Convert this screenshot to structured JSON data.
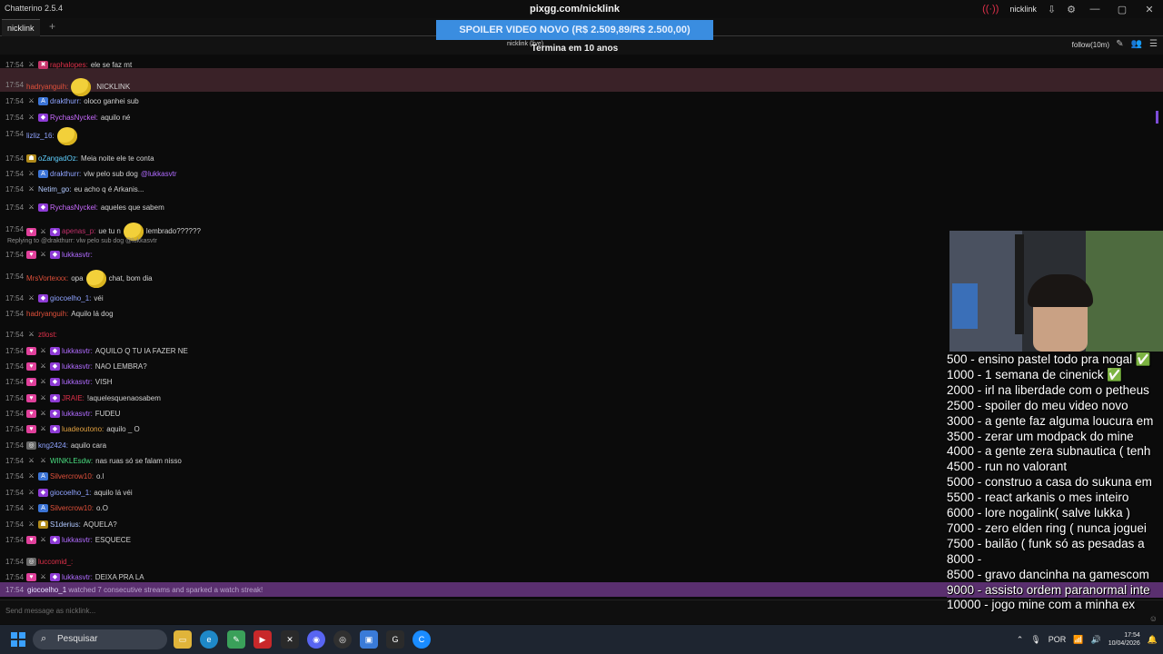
{
  "window": {
    "title": "Chatterino 2.5.4",
    "username": "nicklink"
  },
  "tabs": [
    {
      "label": "nicklink"
    }
  ],
  "banner": {
    "title": "pixgg.com/nicklink",
    "text": "SPOILER VIDEO NOVO (R$ 2.509,89/R$ 2.500,00)",
    "subtitle": "Termina em 10 anos"
  },
  "split_header": {
    "channel": "nicklink (live)",
    "follow_mode": "follow(10m)"
  },
  "messages": [
    {
      "time": "17:54",
      "user": "raphalopes:",
      "user_color": "#e0304a",
      "text": "ele se faz mt"
    },
    {
      "time": "17:54",
      "user": "hadryanguih:",
      "user_color": "#e0503a",
      "text": "NICKLINK"
    },
    {
      "time": "17:54",
      "user": "drakthurr:",
      "user_color": "#8fa3ff",
      "text": "oloco ganhei sub"
    },
    {
      "time": "17:54",
      "user": "RychasNyckel:",
      "user_color": "#c86bff",
      "text": "aquilo né"
    },
    {
      "time": "17:54",
      "user": "lizliz_16:",
      "user_color": "#8fa3ff",
      "text": ""
    },
    {
      "time": "17:54",
      "user": "oZangadOz:",
      "user_color": "#5fd0ff",
      "text": "Meia noite ele te conta"
    },
    {
      "time": "17:54",
      "user": "drakthurr:",
      "user_color": "#8fa3ff",
      "text": "vlw pelo sub dog",
      "mention": "@lukkasvtr"
    },
    {
      "time": "17:54",
      "user": "Netim_go:",
      "user_color": "#b0c8ff",
      "text": "eu acho q é Arkanis..."
    },
    {
      "time": "17:54",
      "user": "RychasNyckel:",
      "user_color": "#c86bff",
      "text": "aqueles que sabem"
    },
    {
      "time": "17:54",
      "user": "apenas_p:",
      "user_color": "#c0306a",
      "text": "ue tu n",
      "text2": "lembrado??????"
    },
    {
      "time": "17:54",
      "user": "lukkasvtr:",
      "user_color": "#b06bff",
      "text": ""
    },
    {
      "time": "17:54",
      "user": "MrsVortexxx:",
      "user_color": "#e0503a",
      "text": "opa",
      "text2": "chat, bom dia"
    },
    {
      "time": "17:54",
      "user": "giocoelho_1:",
      "user_color": "#8fa3ff",
      "text": "véi"
    },
    {
      "time": "17:54",
      "user": "hadryanguih:",
      "user_color": "#e0503a",
      "text": "Aquilo lá dog"
    },
    {
      "time": "17:54",
      "user": "ztlost:",
      "user_color": "#e0304a",
      "text": ""
    },
    {
      "time": "17:54",
      "user": "lukkasvtr:",
      "user_color": "#b06bff",
      "text": "AQUILO Q TU IA FAZER NE"
    },
    {
      "time": "17:54",
      "user": "lukkasvtr:",
      "user_color": "#b06bff",
      "text": "NAO LEMBRA?"
    },
    {
      "time": "17:54",
      "user": "lukkasvtr:",
      "user_color": "#b06bff",
      "text": "VISH"
    },
    {
      "time": "17:54",
      "user": "JRAIE:",
      "user_color": "#e0304a",
      "text": "!aquelesquenaosabem"
    },
    {
      "time": "17:54",
      "user": "lukkasvtr:",
      "user_color": "#b06bff",
      "text": "FUDEU"
    },
    {
      "time": "17:54",
      "user": "luadeoutono:",
      "user_color": "#e0a040",
      "text": "aquilo _ O"
    },
    {
      "time": "17:54",
      "user": "kng2424:",
      "user_color": "#8fa3ff",
      "text": "aquilo cara"
    },
    {
      "time": "17:54",
      "user": "WINKLEsdw:",
      "user_color": "#4ade80",
      "text": "nas ruas só se falam nisso"
    },
    {
      "time": "17:54",
      "user": "Silvercrow10:",
      "user_color": "#e0503a",
      "text": "o.l"
    },
    {
      "time": "17:54",
      "user": "giocoelho_1:",
      "user_color": "#8fa3ff",
      "text": "aquilo lá véi"
    },
    {
      "time": "17:54",
      "user": "Silvercrow10:",
      "user_color": "#e0503a",
      "text": "o.O"
    },
    {
      "time": "17:54",
      "user": "S1derius:",
      "user_color": "#b0c8ff",
      "text": "AQUELA?"
    },
    {
      "time": "17:54",
      "user": "lukkasvtr:",
      "user_color": "#b06bff",
      "text": "ESQUECE"
    },
    {
      "time": "17:54",
      "user": "luccomid_:",
      "user_color": "#e0304a",
      "text": ""
    },
    {
      "time": "17:54",
      "user": "lukkasvtr:",
      "user_color": "#b06bff",
      "text": "DEIXA PRA LA"
    }
  ],
  "reply_context": "Replying to @drakthurr: vlw pelo sub dog @lukkasvtr",
  "watch_streak": {
    "time": "17:54",
    "user": "giocoelho_1",
    "text": "watched 7 consecutive streams and sparked a watch streak!"
  },
  "input": {
    "placeholder": "Send message as nicklink..."
  },
  "goals": [
    "500 - ensino pastel todo pra nogal ✅",
    "1000 - 1 semana de cinenick ✅",
    "2000 - irl na liberdade com o petheus",
    "2500 - spoiler do meu video novo",
    "3000 - a gente faz alguma loucura em",
    "3500 - zerar um modpack do mine",
    "4000 - a gente zera subnautica ( tenh",
    "4500 - run no valorant",
    "5000 - construo a casa do sukuna em",
    "5500 - react arkanis o mes inteiro",
    "6000 - lore nogalink( salve lukka )",
    "7000 - zero elden ring ( nunca joguei",
    "7500  - bailão ( funk só as pesadas a",
    "8000 -",
    "8500 - gravo dancinha na gamescom",
    "9000 - assisto ordem paranormal inte",
    "10000 - jogo mine com a minha ex"
  ],
  "taskbar": {
    "search_placeholder": "Pesquisar",
    "language": "POR",
    "time": "17:54",
    "date": "10/04/2026"
  }
}
